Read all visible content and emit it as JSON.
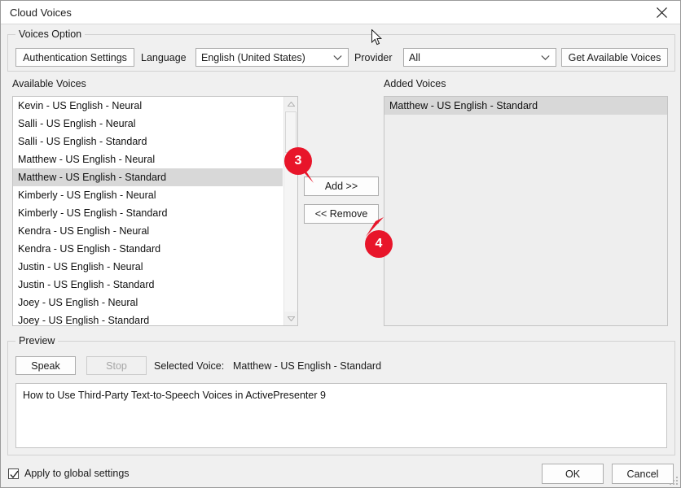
{
  "window": {
    "title": "Cloud Voices",
    "close_icon": "close-icon"
  },
  "voices_option": {
    "legend": "Voices Option",
    "auth_button": "Authentication Settings",
    "language_label": "Language",
    "language_value": "English (United States)",
    "provider_label": "Provider",
    "provider_value": "All",
    "get_voices_button": "Get Available Voices"
  },
  "available": {
    "label": "Available Voices",
    "items": [
      "Kevin - US English - Neural",
      "Salli - US English - Neural",
      "Salli - US English - Standard",
      "Matthew - US English - Neural",
      "Matthew - US English - Standard",
      "Kimberly - US English - Neural",
      "Kimberly - US English - Standard",
      "Kendra - US English - Neural",
      "Kendra - US English - Standard",
      "Justin - US English - Neural",
      "Justin - US English - Standard",
      "Joey - US English - Neural",
      "Joey - US English - Standard"
    ],
    "selected_index": 4
  },
  "transfer": {
    "add_button": "Add >>",
    "remove_button": "<< Remove"
  },
  "added": {
    "label": "Added Voices",
    "items": [
      "Matthew - US English - Standard"
    ],
    "selected_index": 0
  },
  "preview": {
    "legend": "Preview",
    "speak_button": "Speak",
    "stop_button": "Stop",
    "selected_voice_label": "Selected Voice:",
    "selected_voice_value": "Matthew - US English - Standard",
    "text": "How to Use Third-Party Text-to-Speech Voices in ActivePresenter 9"
  },
  "footer": {
    "checkbox_label": "Apply to global settings",
    "ok_button": "OK",
    "cancel_button": "Cancel"
  },
  "callouts": [
    {
      "number": "3"
    },
    {
      "number": "4"
    }
  ],
  "colors": {
    "badge": "#e8152a",
    "dialog_bg": "#f0f0f0",
    "selection": "#d8d8d8",
    "field_bg": "#ffffff"
  }
}
